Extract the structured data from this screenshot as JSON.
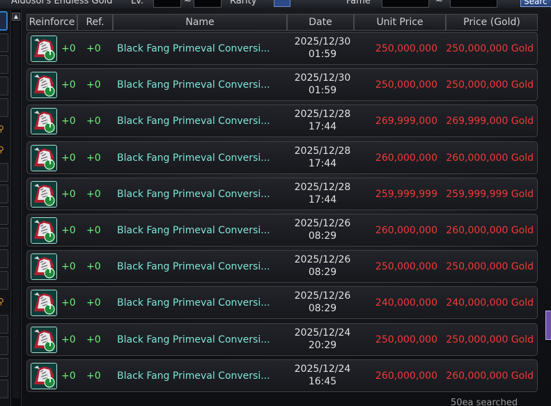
{
  "topbar": {
    "category_text": "Aldosol's Endless Gold",
    "level_label": "Lv.",
    "range_sep": "~",
    "rarity_label": "Rarity",
    "fame_label": "Fame",
    "search_button": "Searc"
  },
  "header": {
    "reinforce": "Reinforce",
    "ref": "Ref.",
    "name": "Name",
    "date": "Date",
    "unit_price": "Unit Price",
    "price": "Price (Gold)"
  },
  "rows": [
    {
      "reinforce": "+0",
      "ref": "+0",
      "name": "Black Fang Primeval Conversi...",
      "date": "2025/12/30",
      "time": "01:59",
      "unit_price": "250,000,000",
      "price": "250,000,000 Gold",
      "icon_badge": "T"
    },
    {
      "reinforce": "+0",
      "ref": "+0",
      "name": "Black Fang Primeval Conversi...",
      "date": "2025/12/30",
      "time": "01:59",
      "unit_price": "250,000,000",
      "price": "250,000,000 Gold",
      "icon_badge": "T"
    },
    {
      "reinforce": "+0",
      "ref": "+0",
      "name": "Black Fang Primeval Conversi...",
      "date": "2025/12/28",
      "time": "17:44",
      "unit_price": "269,999,000",
      "price": "269,999,000 Gold",
      "icon_badge": "T"
    },
    {
      "reinforce": "+0",
      "ref": "+0",
      "name": "Black Fang Primeval Conversi...",
      "date": "2025/12/28",
      "time": "17:44",
      "unit_price": "260,000,000",
      "price": "260,000,000 Gold",
      "icon_badge": "T"
    },
    {
      "reinforce": "+0",
      "ref": "+0",
      "name": "Black Fang Primeval Conversi...",
      "date": "2025/12/28",
      "time": "17:44",
      "unit_price": "259,999,999",
      "price": "259,999,999 Gold",
      "icon_badge": "T"
    },
    {
      "reinforce": "+0",
      "ref": "+0",
      "name": "Black Fang Primeval Conversi...",
      "date": "2025/12/26",
      "time": "08:29",
      "unit_price": "260,000,000",
      "price": "260,000,000 Gold",
      "icon_badge": "T"
    },
    {
      "reinforce": "+0",
      "ref": "+0",
      "name": "Black Fang Primeval Conversi...",
      "date": "2025/12/26",
      "time": "08:29",
      "unit_price": "250,000,000",
      "price": "250,000,000 Gold",
      "icon_badge": "T"
    },
    {
      "reinforce": "+0",
      "ref": "+0",
      "name": "Black Fang Primeval Conversi...",
      "date": "2025/12/26",
      "time": "08:29",
      "unit_price": "240,000,000",
      "price": "240,000,000 Gold",
      "icon_badge": "T"
    },
    {
      "reinforce": "+0",
      "ref": "+0",
      "name": "Black Fang Primeval Conversi...",
      "date": "2025/12/24",
      "time": "20:29",
      "unit_price": "250,000,000",
      "price": "250,000,000 Gold",
      "icon_badge": "T"
    },
    {
      "reinforce": "+0",
      "ref": "+0",
      "name": "Black Fang Primeval Conversi...",
      "date": "2025/12/24",
      "time": "16:45",
      "unit_price": "260,000,000",
      "price": "260,000,000 Gold",
      "icon_badge": "T"
    }
  ],
  "footer": {
    "result_count": "50ea searched"
  },
  "colors": {
    "price_red": "#f03a3a",
    "reinforce_green": "#6ef07a",
    "name_teal": "#7fe6d8"
  }
}
